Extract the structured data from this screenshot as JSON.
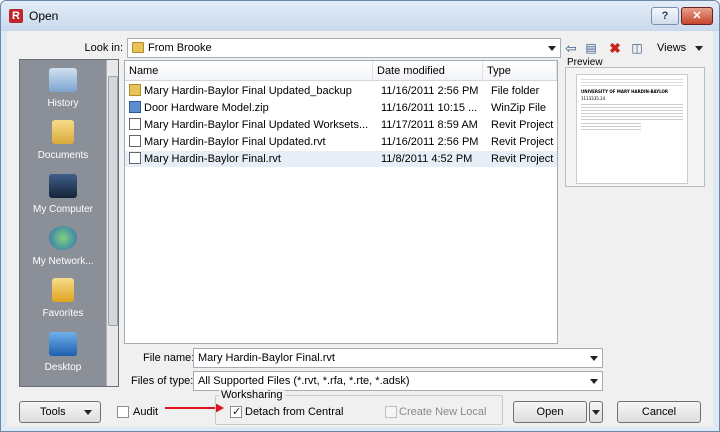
{
  "window": {
    "title": "Open",
    "help": "?",
    "close": "✕"
  },
  "toolbar": {
    "look_in_label": "Look in:",
    "look_in_value": "From Brooke",
    "views_label": "Views"
  },
  "places": [
    {
      "label": "History",
      "icon": "history-icon"
    },
    {
      "label": "Documents",
      "icon": "documents-icon"
    },
    {
      "label": "My Computer",
      "icon": "computer-icon"
    },
    {
      "label": "My Network...",
      "icon": "network-icon"
    },
    {
      "label": "Favorites",
      "icon": "favorites-icon"
    },
    {
      "label": "Desktop",
      "icon": "desktop-icon"
    }
  ],
  "filelist": {
    "columns": [
      "Name",
      "Date modified",
      "Type"
    ],
    "rows": [
      {
        "name": "Mary Hardin-Baylor Final Updated_backup",
        "date": "11/16/2011 2:56 PM",
        "type": "File folder",
        "icon": "folder-icon"
      },
      {
        "name": "Door Hardware Model.zip",
        "date": "11/16/2011 10:15 ...",
        "type": "WinZip File",
        "icon": "zip-icon"
      },
      {
        "name": "Mary Hardin-Baylor Final Updated Worksets...",
        "date": "11/17/2011 8:59 AM",
        "type": "Revit Project",
        "icon": "rvt-icon"
      },
      {
        "name": "Mary Hardin-Baylor Final Updated.rvt",
        "date": "11/16/2011 2:56 PM",
        "type": "Revit Project",
        "icon": "rvt-icon"
      },
      {
        "name": "Mary Hardin-Baylor Final.rvt",
        "date": "11/8/2011 4:52 PM",
        "type": "Revit Project",
        "icon": "rvt-icon"
      }
    ]
  },
  "preview": {
    "label": "Preview",
    "page_lines": [
      "UNIVERSITY OF MARY HARDIN-BAYLOR",
      "1113335.24"
    ]
  },
  "form": {
    "file_name_label": "File name:",
    "file_name_value": "Mary Hardin-Baylor Final.rvt",
    "file_type_label": "Files of type:",
    "file_type_value": "All Supported Files  (*.rvt,  *.rfa,  *.rte,  *.adsk)"
  },
  "bottom": {
    "tools_label": "Tools",
    "audit_label": "Audit",
    "worksharing_label": "Worksharing",
    "detach_label": "Detach from Central",
    "detach_checked": true,
    "create_local_label": "Create New Local",
    "open_label": "Open",
    "cancel_label": "Cancel"
  },
  "colors": {
    "annotation_arrow": "#e01020",
    "selected_row": "#e8eef7"
  }
}
